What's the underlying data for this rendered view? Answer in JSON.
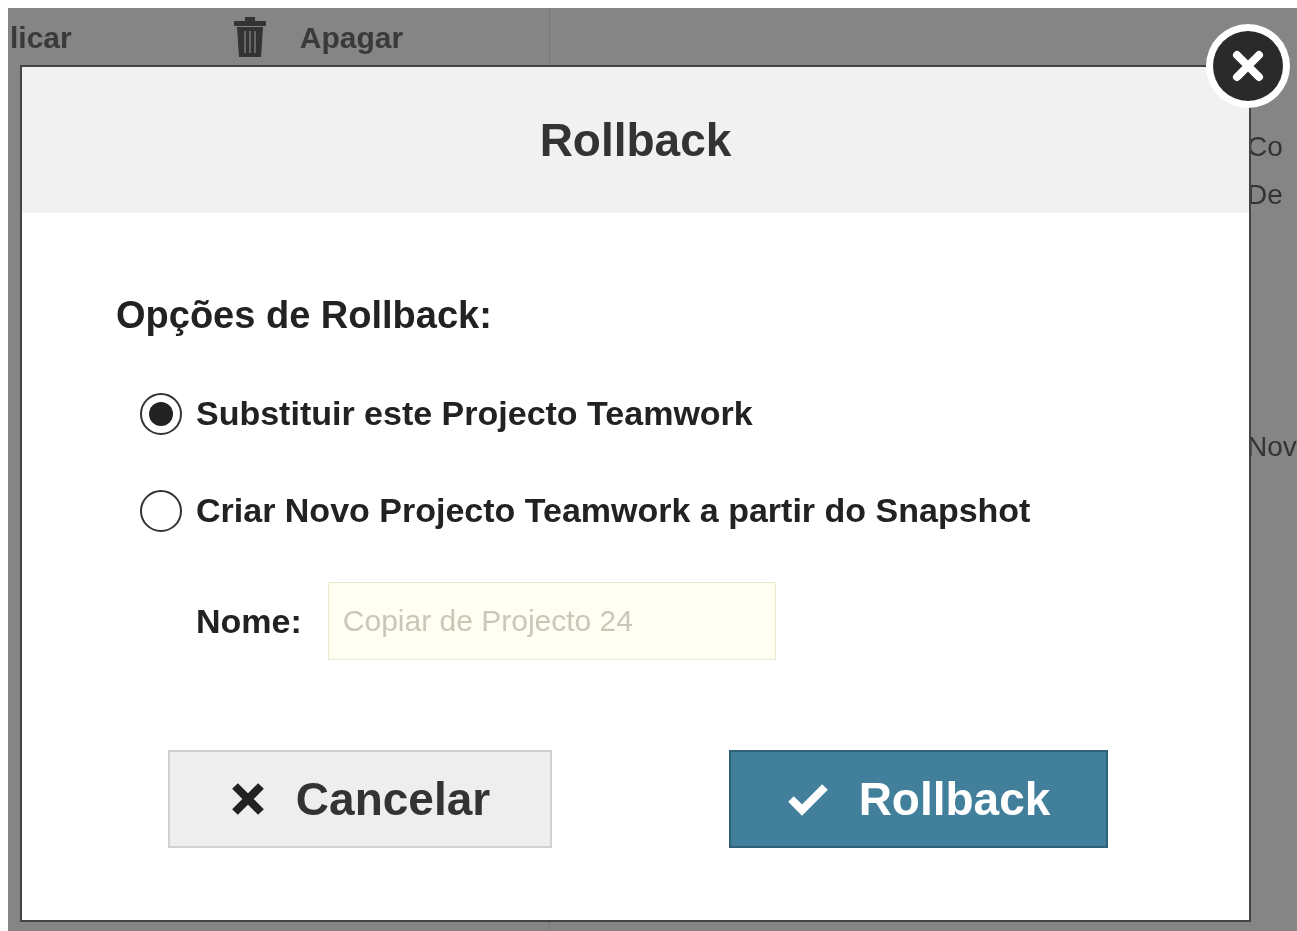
{
  "background": {
    "toolbar": [
      {
        "label": "licar",
        "kind": "text"
      },
      {
        "label": "Apagar",
        "kind": "delete"
      }
    ],
    "side_texts": [
      "Co",
      "De",
      "Nov"
    ]
  },
  "dialog": {
    "title": "Rollback",
    "section_label": "Opções de Rollback:",
    "options": [
      {
        "label": "Substituir este Projecto Teamwork",
        "selected": true
      },
      {
        "label": "Criar Novo Projecto Teamwork a partir do Snapshot",
        "selected": false
      }
    ],
    "name_field": {
      "label": "Nome:",
      "placeholder": "Copiar de Projecto 24"
    },
    "buttons": [
      {
        "label": "Cancelar",
        "kind": "cancel"
      },
      {
        "label": "Rollback",
        "kind": "confirm"
      }
    ]
  }
}
